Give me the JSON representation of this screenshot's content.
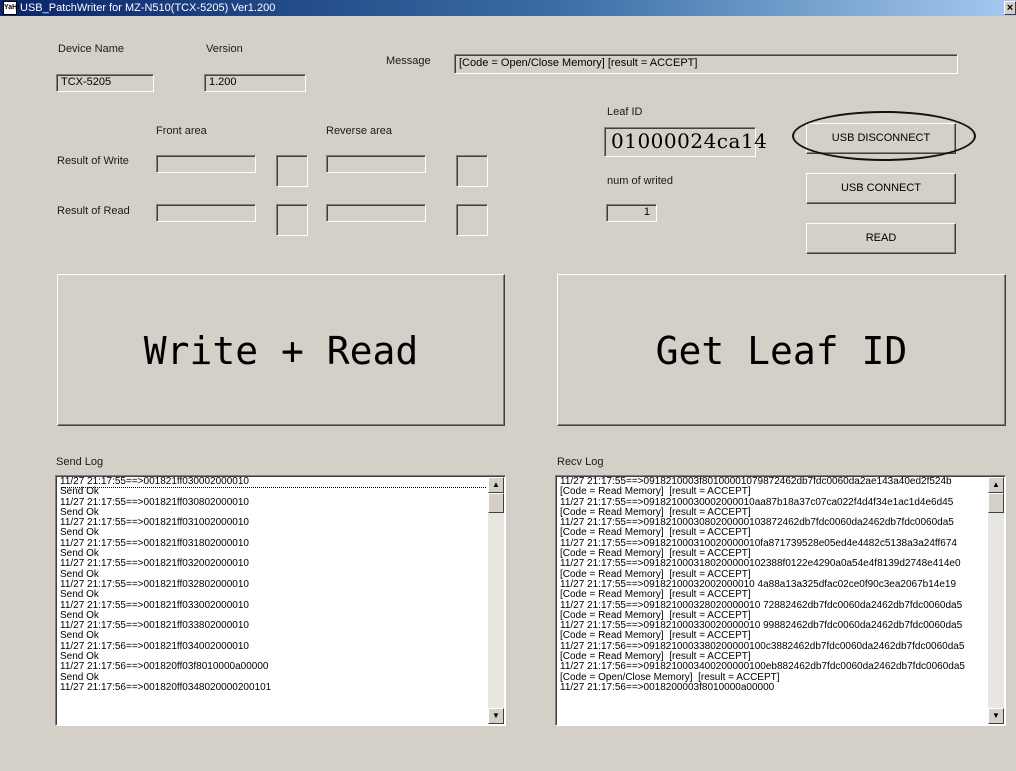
{
  "window": {
    "title": "USB_PatchWriter for MZ-N510(TCX-5205) Ver1.200",
    "icon_text": "YaHi",
    "close_glyph": "×"
  },
  "device": {
    "name_label": "Device Name",
    "name_value": "TCX-5205",
    "version_label": "Version",
    "version_value": "1.200"
  },
  "message": {
    "label": "Message",
    "value": "[Code = Open/Close Memory]  [result = ACCEPT]"
  },
  "areas": {
    "front_label": "Front area",
    "reverse_label": "Reverse area",
    "result_write_label": "Result of Write",
    "result_read_label": "Result of Read"
  },
  "leaf": {
    "label": "Leaf ID",
    "value": "01000024ca14",
    "num_label": "num of writed",
    "num_value": "1"
  },
  "buttons": {
    "usb_disconnect": "USB DISCONNECT",
    "usb_connect": "USB CONNECT",
    "read": "READ",
    "write_read": "Write + Read",
    "get_leaf_id": "Get Leaf ID"
  },
  "send_log": {
    "label": "Send Log",
    "lines": [
      "11/27 21:17:55==>001821ff030002000010",
      "Send Ok",
      "11/27 21:17:55==>001821ff030802000010",
      "Send Ok",
      "11/27 21:17:55==>001821ff031002000010",
      "Send Ok",
      "11/27 21:17:55==>001821ff031802000010",
      "Send Ok",
      "11/27 21:17:55==>001821ff032002000010",
      "Send Ok",
      "11/27 21:17:55==>001821ff032802000010",
      "Send Ok",
      "11/27 21:17:55==>001821ff033002000010",
      "Send Ok",
      "11/27 21:17:55==>001821ff033802000010",
      "Send Ok",
      "11/27 21:17:56==>001821ff034002000010",
      "Send Ok",
      "11/27 21:17:56==>001820ff03f8010000a00000",
      "Send Ok",
      "11/27 21:17:56==>001820ff0348020000200101"
    ]
  },
  "recv_log": {
    "label": "Recv Log",
    "lines": [
      "11/27 21:17:55==>0918210003f80100001079872462db7fdc0060da2ae143a40ed2f524b",
      "[Code = Read Memory]  [result = ACCEPT]",
      "11/27 21:17:55==>09182100030002000010aa87b18a37c07ca022f4d4f34e1ac1d4e6d45",
      "[Code = Read Memory]  [result = ACCEPT]",
      "11/27 21:17:55==>0918210003080200000103872462db7fdc0060da2462db7fdc0060da5",
      "[Code = Read Memory]  [result = ACCEPT]",
      "11/27 21:17:55==>091821000310020000010fa871739528e05ed4e4482c5138a3a24ff674",
      "[Code = Read Memory]  [result = ACCEPT]",
      "11/27 21:17:55==>0918210003180200000102388f0122e4290a0a54e4f8139d2748e414e0",
      "[Code = Read Memory]  [result = ACCEPT]",
      "11/27 21:17:55==>09182100032002000010 4a88a13a325dfac02ce0f90c3ea2067b14e19",
      "[Code = Read Memory]  [result = ACCEPT]",
      "11/27 21:17:55==>091821000328020000010 72882462db7fdc0060da2462db7fdc0060da5",
      "[Code = Read Memory]  [result = ACCEPT]",
      "11/27 21:17:55==>091821000330020000010 99882462db7fdc0060da2462db7fdc0060da5",
      "[Code = Read Memory]  [result = ACCEPT]",
      "11/27 21:17:56==>0918210003380200000100c3882462db7fdc0060da2462db7fdc0060da5",
      "[Code = Read Memory]  [result = ACCEPT]",
      "11/27 21:17:56==>0918210003400200000100eb882462db7fdc0060da2462db7fdc0060da5",
      "[Code = Open/Close Memory]  [result = ACCEPT]",
      "11/27 21:17:56==>0018200003f8010000a00000"
    ]
  }
}
